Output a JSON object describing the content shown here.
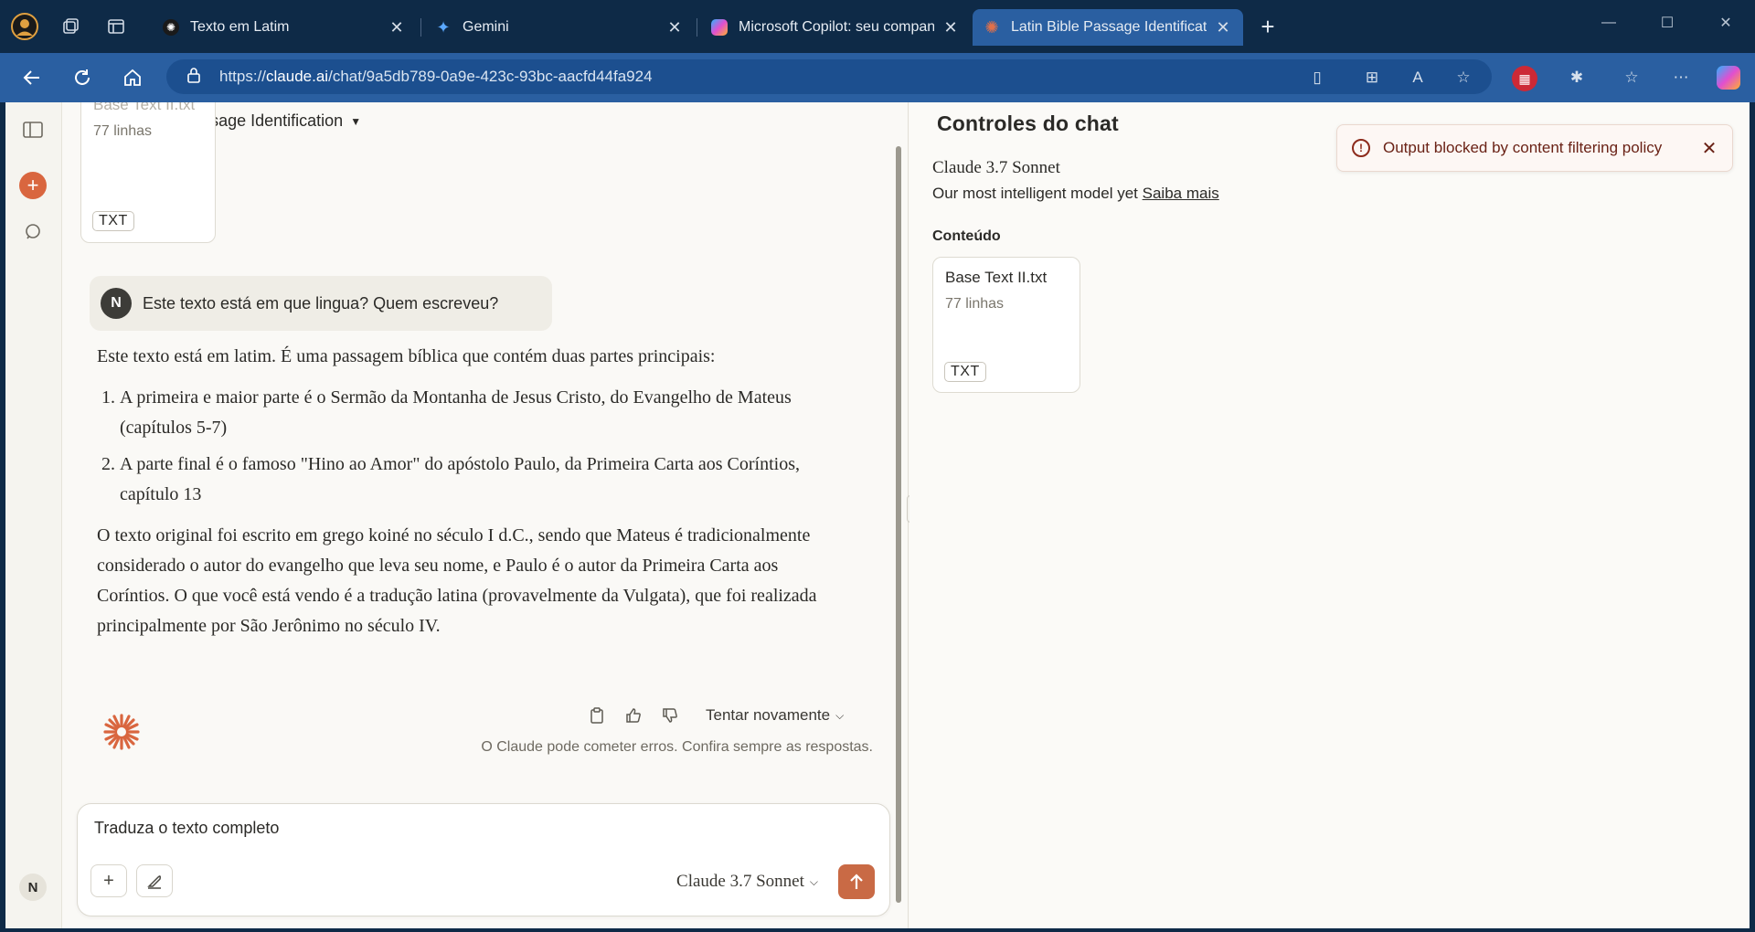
{
  "browser": {
    "tabs": [
      {
        "title": "Texto em Latim",
        "active": false
      },
      {
        "title": "Gemini",
        "active": false
      },
      {
        "title": "Microsoft Copilot: seu companheiro de IA",
        "active": false
      },
      {
        "title": "Latin Bible Passage Identification",
        "active": true
      }
    ],
    "url_prefix": "https://",
    "url_domain": "claude.ai",
    "url_path": "/chat/9a5db789-0a9e-423c-93bc-aacfd44fa924"
  },
  "chat": {
    "title": "Latin Bible Passage Identification",
    "top_file": {
      "name": "Base Text II.txt",
      "lines": "77 linhas",
      "type": "TXT"
    },
    "user": {
      "initial": "N",
      "message": "Este texto está em que lingua? Quem escreveu?"
    },
    "answer": {
      "intro": "Este texto está em latim. É uma passagem bíblica que contém duas partes principais:",
      "items": [
        "A primeira e maior parte é o Sermão da Montanha de Jesus Cristo, do Evangelho de Mateus (capítulos 5-7)",
        "A parte final é o famoso \"Hino ao Amor\" do apóstolo Paulo, da Primeira Carta aos Coríntios, capítulo 13"
      ],
      "closing": "O texto original foi escrito em grego koiné no século I d.C., sendo que Mateus é tradicionalmente considerado o autor do evangelho que leva seu nome, e Paulo é o autor da Primeira Carta aos Coríntios. O que você está vendo é a tradução latina (provavelmente da Vulgata), que foi realizada principalmente por São Jerônimo no século IV."
    },
    "retry_label": "Tentar novamente",
    "disclaimer": "O Claude pode cometer erros. Confira sempre as respostas.",
    "composer": {
      "value": "Traduza o texto completo",
      "model": "Claude 3.7 Sonnet"
    },
    "user_avatar": "N"
  },
  "panel": {
    "title": "Controles do chat",
    "model_name": "Claude 3.7 Sonnet",
    "model_desc": "Our most intelligent model yet",
    "learn_more": "Saiba mais",
    "content_label": "Conteúdo",
    "file": {
      "name": "Base Text II.txt",
      "lines": "77 linhas",
      "type": "TXT"
    }
  },
  "toast": {
    "message": "Output blocked by content filtering policy"
  },
  "colors": {
    "titlebar": "#0e2a47",
    "navbar": "#2a5fa1",
    "accent": "#d9663f",
    "error": "#8d2b1c"
  }
}
